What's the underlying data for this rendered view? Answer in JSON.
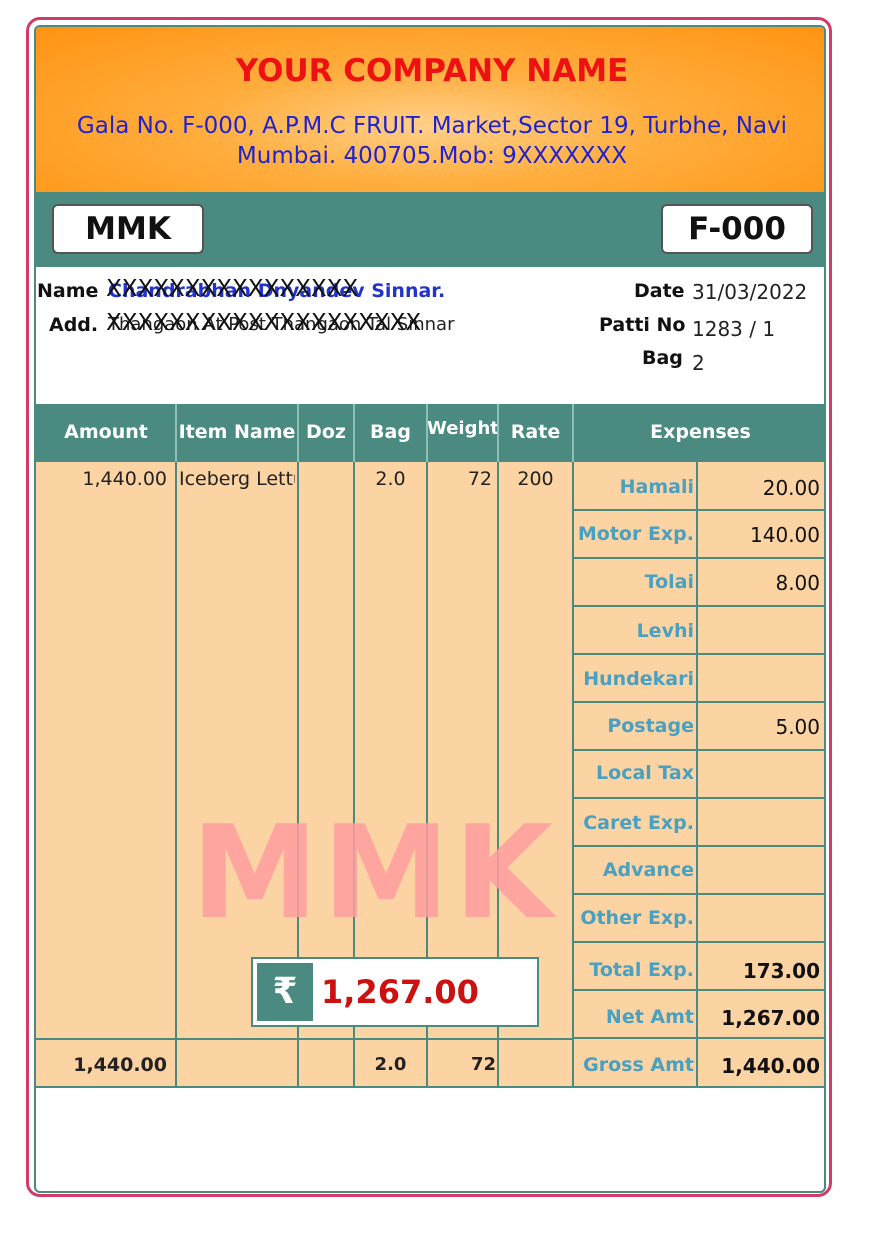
{
  "company": {
    "name": "YOUR COMPANY NAME",
    "address": "Gala No. F-000, A.P.M.C FRUIT. Market,Sector 19, Turbhe, Navi Mumbai. 400705.Mob: 9XXXXXXX"
  },
  "codes": {
    "left": "MMK",
    "right": "F-000"
  },
  "info": {
    "name_label": "Name",
    "name_value": "Chandrabhan Dnyandev Sinnar.",
    "name_mask": "XXXXXXXXXXXXXXXX",
    "add_label": "Add.",
    "add_value": "Thangaon At Post Thangaon Tal Sinnar",
    "add_mask": "XXXXXXXXXXXXXXXXXXXX",
    "date_label": "Date",
    "date_value": "31/03/2022",
    "patti_label": "Patti No",
    "patti_value": "1283 / 1",
    "bag_label": "Bag",
    "bag_value": "2"
  },
  "table": {
    "headers": {
      "amount": "Amount",
      "item": "Item Name",
      "doz": "Doz",
      "bag": "Bag",
      "weight": "Weight",
      "rate": "Rate",
      "expenses": "Expenses"
    },
    "row": {
      "amount": "1,440.00",
      "item": "Iceberg Lettu",
      "doz": "",
      "bag": "2.0",
      "weight": "72",
      "rate": "200"
    },
    "totals": {
      "amount": "1,440.00",
      "bag": "2.0",
      "weight": "72"
    }
  },
  "expenses": [
    {
      "label": "Hamali",
      "value": "20.00"
    },
    {
      "label": "Motor Exp.",
      "value": "140.00"
    },
    {
      "label": "Tolai",
      "value": "8.00"
    },
    {
      "label": "Levhi",
      "value": ""
    },
    {
      "label": "Hundekari",
      "value": ""
    },
    {
      "label": "Postage",
      "value": "5.00"
    },
    {
      "label": "Local Tax",
      "value": ""
    },
    {
      "label": "Caret Exp.",
      "value": ""
    },
    {
      "label": "Advance",
      "value": ""
    },
    {
      "label": "Other Exp.",
      "value": ""
    }
  ],
  "summary": [
    {
      "label": "Total Exp.",
      "value": "173.00"
    },
    {
      "label": "Net Amt",
      "value": "1,267.00"
    },
    {
      "label": "Gross Amt",
      "value": "1,440.00"
    }
  ],
  "watermark": "MMK",
  "net_box": {
    "symbol": "₹",
    "value": "1,267.00"
  },
  "colors": {
    "border": "#d23a6a",
    "teal": "#4a8a80",
    "body": "#fcd4a3",
    "title": "#ee1111",
    "address": "#2222cc",
    "label": "#4aa0c0"
  }
}
